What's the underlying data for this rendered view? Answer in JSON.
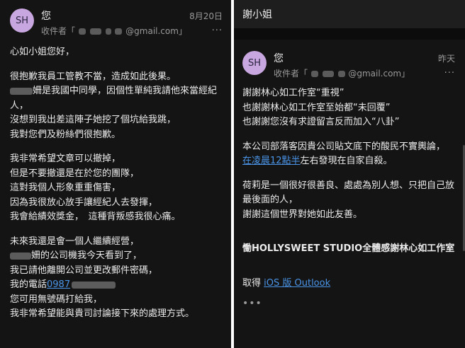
{
  "left": {
    "avatar": "SH",
    "sender": "您",
    "date": "8月20日",
    "recipient_prefix": "收件者「",
    "recipient_suffix": "@gmail.com」",
    "menu_glyph": "···",
    "body": {
      "greeting": "心如小姐您好，",
      "p1": [
        "很抱歉我員工管教不當，造成如此後果。",
        "姍是我國中同學，因個性單純我請他來當經紀人，",
        "沒想到我出差這陣子她挖了個坑給我跳，",
        "我對您們及粉絲們很抱歉。"
      ],
      "p2": [
        "我非常希望文章可以撤掉，",
        "但是不要撤還是在於您的團隊，",
        "這對我個人形象重重傷害，",
        "因為我很放心放手讓經紀人去發揮，",
        "我會給績效獎金，　這種背叛感我很心痛。"
      ],
      "p3_l1": "未來我還是會一個人繼續經營，",
      "p3_l2": "姍的公司機我今天看到了，",
      "p3_l3": "我已請他離開公司並更改郵件密碼，",
      "p3_l4_prefix": "我的電話",
      "phone": "0987",
      "p3_l5": "您可用無號碼打給我，",
      "p3_l6": "我非常希望能與貴司討論接下來的處理方式。"
    }
  },
  "right": {
    "title": "謝小姐",
    "avatar": "SH",
    "sender": "您",
    "date": "昨天",
    "recipient_prefix": "收件者「",
    "recipient_suffix": "@gmail.com」",
    "menu_glyph": "···",
    "body": {
      "p1": [
        "謝謝林心如工作室“重視”",
        "也謝謝林心如工作室至始都“未回覆”",
        "也謝謝您沒有求證留言反而加入“八卦”"
      ],
      "p2_l1": "本公司部落客因貴公司貼文底下的酸民不實輿論，",
      "p2_link": "在凌晨12點半",
      "p2_l2_rest": "左右發現在自家自殺。",
      "p3": [
        "荷莉是一個很好很善良、處處為別人想、只把自己放最後面的人，",
        "謝謝這個世界對她如此友善。"
      ],
      "signature": "慟HOLLYSWEET STUDIO全體感謝林心如工作室",
      "footer_prefix": "取得 ",
      "footer_link": "iOS 版 Outlook",
      "more": "•••"
    }
  }
}
